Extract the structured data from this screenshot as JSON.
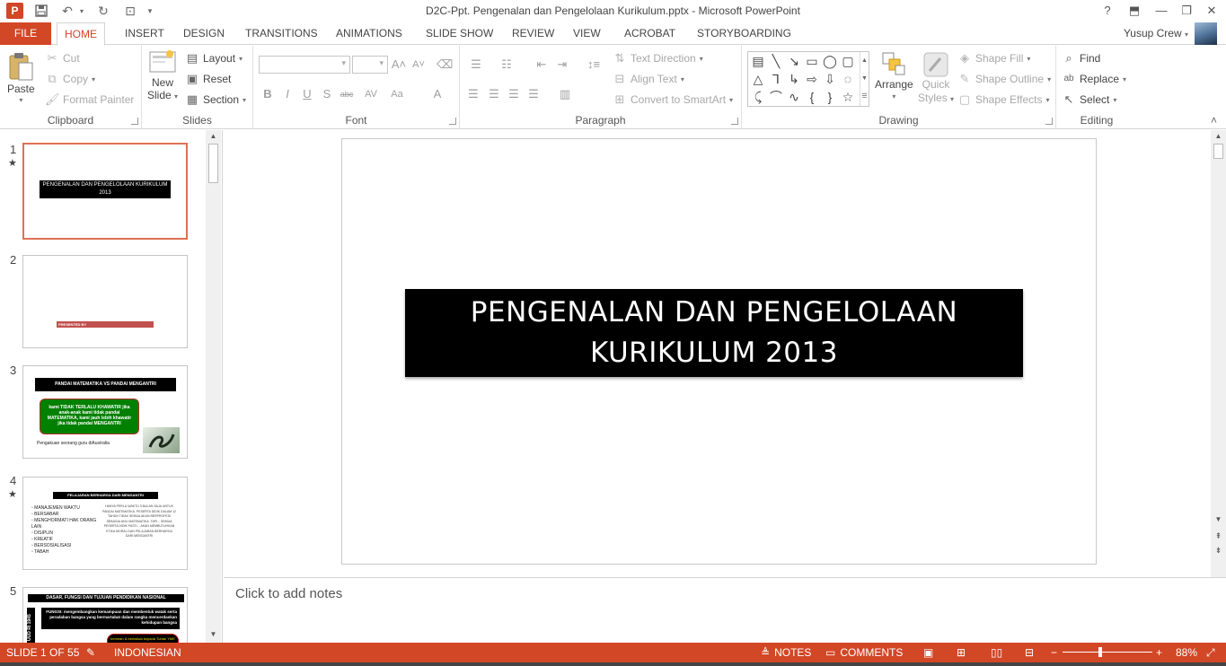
{
  "app": {
    "window_title": "D2C-Ppt. Pengenalan dan Pengelolaan Kurikulum.pptx - Microsoft PowerPoint",
    "icon_letter": "P",
    "help": "?"
  },
  "tabs": {
    "file": "FILE",
    "items": [
      "HOME",
      "INSERT",
      "DESIGN",
      "TRANSITIONS",
      "ANIMATIONS",
      "SLIDE SHOW",
      "REVIEW",
      "VIEW",
      "ACROBAT",
      "STORYBOARDING"
    ],
    "active": "HOME",
    "user": "Yusup Crew"
  },
  "ribbon": {
    "clipboard": {
      "label": "Clipboard",
      "paste": "Paste",
      "cut": "Cut",
      "copy": "Copy",
      "format_painter": "Format Painter"
    },
    "slides": {
      "label": "Slides",
      "new_slide_1": "New",
      "new_slide_2": "Slide",
      "layout": "Layout",
      "reset": "Reset",
      "section": "Section"
    },
    "font": {
      "label": "Font",
      "bold": "B",
      "italic": "I",
      "underline": "U",
      "shadow": "S",
      "strike": "abc",
      "spacing": "AV",
      "case": "Aa",
      "color": "A",
      "grow": "A",
      "shrink": "A"
    },
    "paragraph": {
      "label": "Paragraph",
      "text_direction": "Text Direction",
      "align_text": "Align Text",
      "smartart": "Convert to SmartArt"
    },
    "drawing": {
      "label": "Drawing",
      "arrange": "Arrange",
      "quick_styles_1": "Quick",
      "quick_styles_2": "Styles",
      "shape_fill": "Shape Fill",
      "shape_outline": "Shape Outline",
      "shape_effects": "Shape Effects"
    },
    "editing": {
      "label": "Editing",
      "find": "Find",
      "replace": "Replace",
      "select": "Select"
    }
  },
  "thumbnails": [
    {
      "number": "1",
      "starred": true,
      "title": "PENGENALAN DAN PENGELOLAAN KURIKULUM 2013"
    },
    {
      "number": "2",
      "starred": false,
      "title": "PRESENTED BY"
    },
    {
      "number": "3",
      "starred": false,
      "title": "PANDAI MATEMATIKA VS PANDAI  MENGANTRI",
      "bubble": "kami TIDAK TERLALU KHAWATIR jika anak-anak kami tidak pandai MATEMATIKA, kami jauh lebih khawatir jika tidak pandai MENGANTRI",
      "caption": "Pengakuan seorang guru diAustralia"
    },
    {
      "number": "4",
      "starred": true,
      "title": "PELAJARAN BERHARGA DARI MENGANTRI",
      "list": [
        "MANAJEMEN WAKTU",
        "BERSABAR",
        "MENGHORMATI HAK ORANG LAIN",
        "DISIPLIN",
        "KREATIF",
        "BERSOSIALISASI",
        "TABAH"
      ],
      "right_text": "HANYA PERLU WAKTU 3 BULAN SAJA UNTUK PANDAI MATEMATIKA. PESERTA DIDIK DALAM 12 TAHUN TIDAK SEMUA AKAN BERPROFESI SEBAGAI AHLI MATEMATIKA. TAPI... SEMUA PESERTA DIDIK PASTI... AKAN MEMBUTUHKAN ETIKA MORAL DAN PELAJARAN BERHARGA DARI MENGANTRI"
    },
    {
      "number": "5",
      "starred": false,
      "title": "DASAR, FUNGSI DAN TUJUAN PENDIDIKAN NASIONAL",
      "side": "UUD RI 1945",
      "body": "FUNGSI: mengembangkan kemampuan dan membentuk watak serta peradaban bangsa yang bermartabat dalam rangka mencerdaskan kehidupan bangsa",
      "badge": "beriman & bertakwa kepada Tuhan YME"
    }
  ],
  "slide": {
    "title_line1": "PENGENALAN DAN PENGELOLAAN",
    "title_line2": "KURIKULUM 2013"
  },
  "notes": {
    "placeholder": "Click to add notes"
  },
  "status": {
    "slide_info": "SLIDE 1 OF 55",
    "language": "INDONESIAN",
    "notes": "NOTES",
    "comments": "COMMENTS",
    "zoom": "88%",
    "zoom_level": 0.42
  },
  "colors": {
    "accent": "#d24726",
    "thumb3_title_bar": "#000000",
    "thumb2_bar": "#c0504d",
    "thumb3_bubble": "#008000"
  }
}
